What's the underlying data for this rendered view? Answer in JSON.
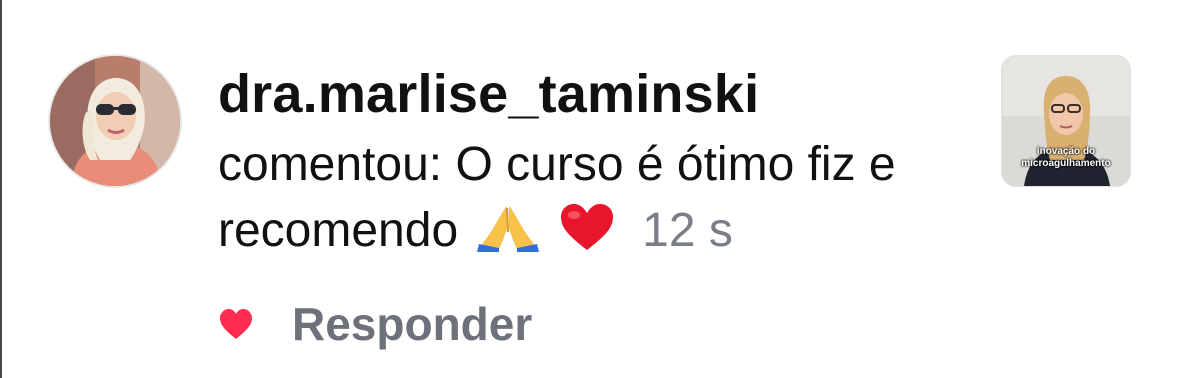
{
  "notification": {
    "username": "dra.marlise_taminski",
    "comment_text": "comentou: O curso é ótimo fiz e recomendo",
    "emojis": [
      "🙏",
      "❤️"
    ],
    "timestamp": "12 s",
    "reply_label": "Responder",
    "liked": true
  },
  "thumbnail": {
    "caption_line1": "inovação do",
    "caption_line2": "microagulhamento"
  },
  "colors": {
    "text": "#111111",
    "muted": "#7a7f87",
    "reply": "#6d717a",
    "like": "#ff2d4f",
    "background": "#ffffff"
  },
  "icons": {
    "avatar": "profile-photo",
    "like": "heart-icon",
    "pray": "folded-hands-emoji",
    "heart_emoji": "red-heart-emoji"
  }
}
